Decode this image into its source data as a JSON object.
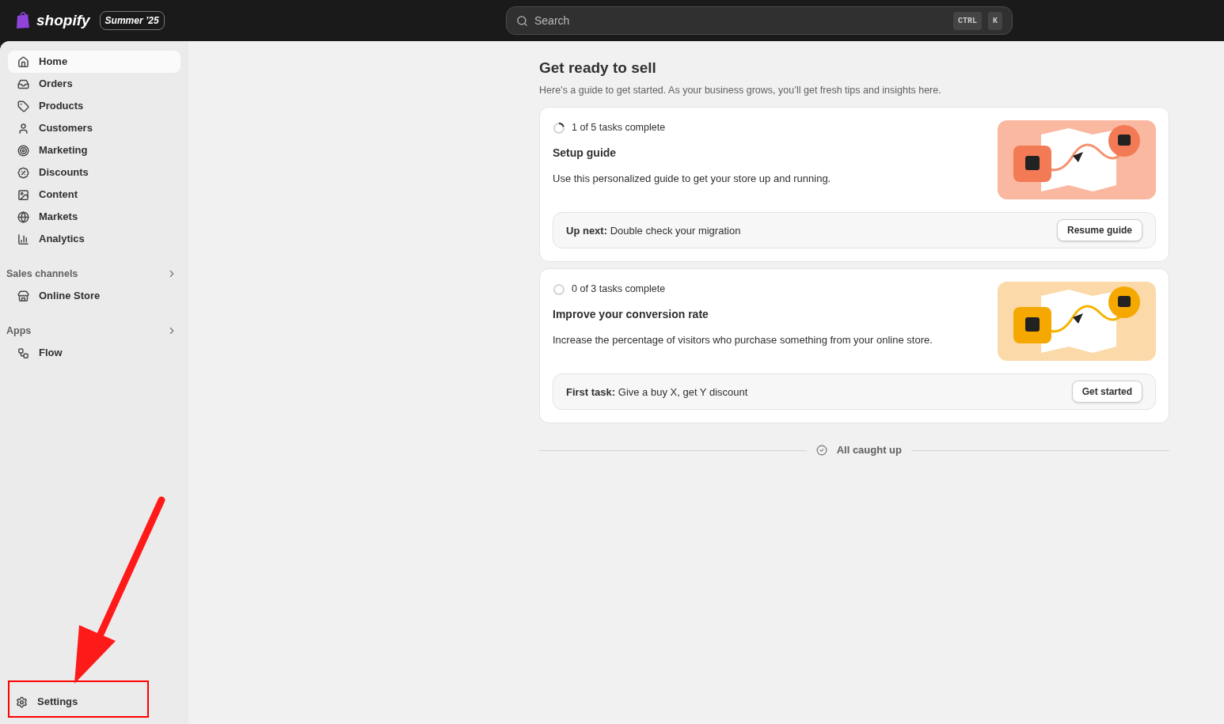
{
  "topbar": {
    "brand": "shopify",
    "edition": "Summer ’25",
    "search": {
      "placeholder": "Search",
      "keys": [
        "CTRL",
        "K"
      ]
    }
  },
  "sidebar": {
    "items": [
      {
        "label": "Home",
        "selected": true
      },
      {
        "label": "Orders",
        "selected": false
      },
      {
        "label": "Products",
        "selected": false
      },
      {
        "label": "Customers",
        "selected": false
      },
      {
        "label": "Marketing",
        "selected": false
      },
      {
        "label": "Discounts",
        "selected": false
      },
      {
        "label": "Content",
        "selected": false
      },
      {
        "label": "Markets",
        "selected": false
      },
      {
        "label": "Analytics",
        "selected": false
      }
    ],
    "sections": [
      {
        "title": "Sales channels",
        "items": [
          {
            "label": "Online Store",
            "selected": false
          }
        ]
      },
      {
        "title": "Apps",
        "items": [
          {
            "label": "Flow",
            "selected": false
          }
        ]
      }
    ],
    "settings": {
      "label": "Settings"
    }
  },
  "main": {
    "title": "Get ready to sell",
    "subtitle": "Here’s a guide to get started. As your business grows, you’ll get fresh tips and insights here.",
    "cards": [
      {
        "progress": "1 of 5 tasks complete",
        "title": "Setup guide",
        "description": "Use this personalized guide to get your store up and running.",
        "next_label": "Up next:",
        "next_text": "Double check your migration",
        "button": "Resume guide"
      },
      {
        "progress": "0 of 3 tasks complete",
        "title": "Improve your conversion rate",
        "description": "Increase the percentage of visitors who purchase something from your online store.",
        "next_label": "First task:",
        "next_text": "Give a buy X, get Y discount",
        "button": "Get started"
      }
    ],
    "footer": "All caught up"
  }
}
